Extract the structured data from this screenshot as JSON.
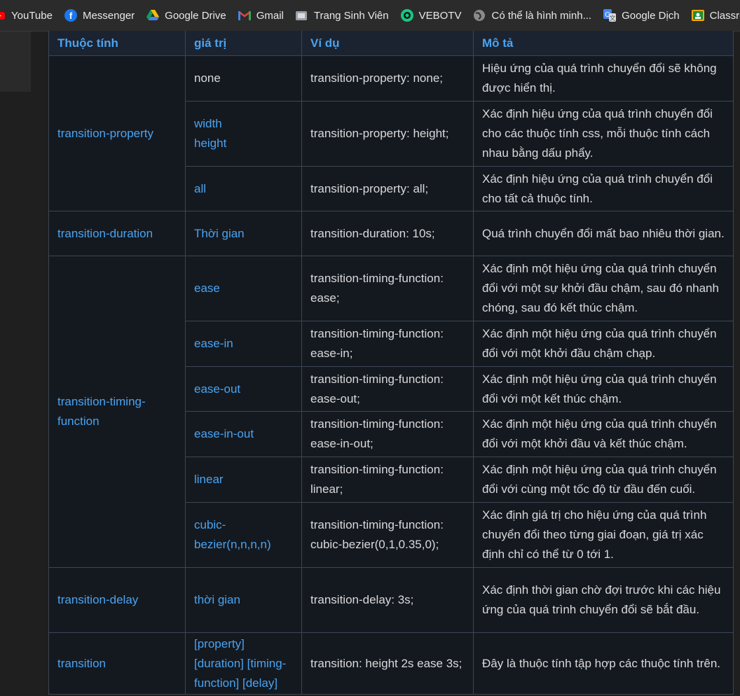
{
  "bookmarks": [
    {
      "label": "YouTube",
      "icon": "youtube-icon"
    },
    {
      "label": "Messenger",
      "icon": "messenger-icon"
    },
    {
      "label": "Google Drive",
      "icon": "google-drive-icon"
    },
    {
      "label": "Gmail",
      "icon": "gmail-icon"
    },
    {
      "label": "Trang Sinh Viên",
      "icon": "folder-icon"
    },
    {
      "label": "VEBOTV",
      "icon": "vebotv-icon"
    },
    {
      "label": "Có thể là hình minh...",
      "icon": "globe-icon"
    },
    {
      "label": "Google Dịch",
      "icon": "google-translate-icon"
    },
    {
      "label": "Classro",
      "icon": "classroom-icon"
    }
  ],
  "table": {
    "headers": [
      "Thuộc tính",
      "giá trị",
      "Ví dụ",
      "Mô tả"
    ],
    "groups": [
      {
        "property": "transition-property",
        "rows": [
          {
            "value": "none",
            "value_plain": true,
            "example": "transition-property: none;",
            "desc": "Hiệu ứng của quá trình chuyển đổi sẽ không được hiển thị."
          },
          {
            "value": "width\nheight",
            "example": "transition-property: height;",
            "desc": "Xác định hiệu ứng của quá trình chuyển đổi cho các thuộc tính css, mỗi thuộc tính cách nhau bằng dấu phẩy."
          },
          {
            "value": "all",
            "example": "transition-property: all;",
            "desc": "Xác định hiệu ứng của quá trình chuyển đổi cho tất cả thuộc tính."
          }
        ]
      },
      {
        "property": "transition-duration",
        "rows": [
          {
            "value": "Thời gian",
            "example": "transition-duration: 10s;",
            "desc": "Quá trình chuyển đổi mất bao nhiêu thời gian."
          }
        ]
      },
      {
        "property": "transition-timing-function",
        "rows": [
          {
            "value": "ease",
            "example": "transition-timing-function: ease;",
            "desc": "Xác định một hiệu ứng của quá trình chuyển đổi với một sự khởi đầu chậm, sau đó nhanh chóng, sau đó kết thúc chậm."
          },
          {
            "value": "ease-in",
            "example": "transition-timing-function: ease-in;",
            "desc": "Xác định một hiệu ứng của quá trình chuyển đổi với một khởi đầu chậm chạp."
          },
          {
            "value": "ease-out",
            "example": "transition-timing-function: ease-out;",
            "desc": "Xác định một hiệu ứng của quá trình chuyển đổi với một kết thúc chậm."
          },
          {
            "value": "ease-in-out",
            "example": "transition-timing-function: ease-in-out;",
            "desc": "Xác định một hiệu ứng của quá trình chuyển đổi với một khởi đầu và kết thúc chậm."
          },
          {
            "value": "linear",
            "example": "transition-timing-function: linear;",
            "desc": "Xác định một hiệu ứng của quá trình chuyển đổi với cùng một tốc độ từ đầu đến cuối."
          },
          {
            "value": "cubic-bezier(n,n,n,n)",
            "example": "transition-timing-function: cubic-bezier(0,1,0.35,0);",
            "desc": "Xác định giá trị cho hiệu ứng của quá trình chuyển đổi theo từng giai đoạn, giá trị xác định chỉ có thể từ 0 tới 1."
          }
        ]
      },
      {
        "property": "transition-delay",
        "rows": [
          {
            "value": "thời gian",
            "example": "transition-delay: 3s;",
            "desc": "Xác định thời gian chờ đợi trước khi các hiệu ứng của quá trình chuyển đổi sẽ bắt đầu."
          }
        ]
      },
      {
        "property": "transition",
        "rows": [
          {
            "value": "[property] [duration] [timing-function] [delay]",
            "example": "transition: height 2s ease 3s;",
            "desc": "Đây là thuộc tính tập hợp các thuộc tính trên."
          }
        ]
      }
    ]
  }
}
